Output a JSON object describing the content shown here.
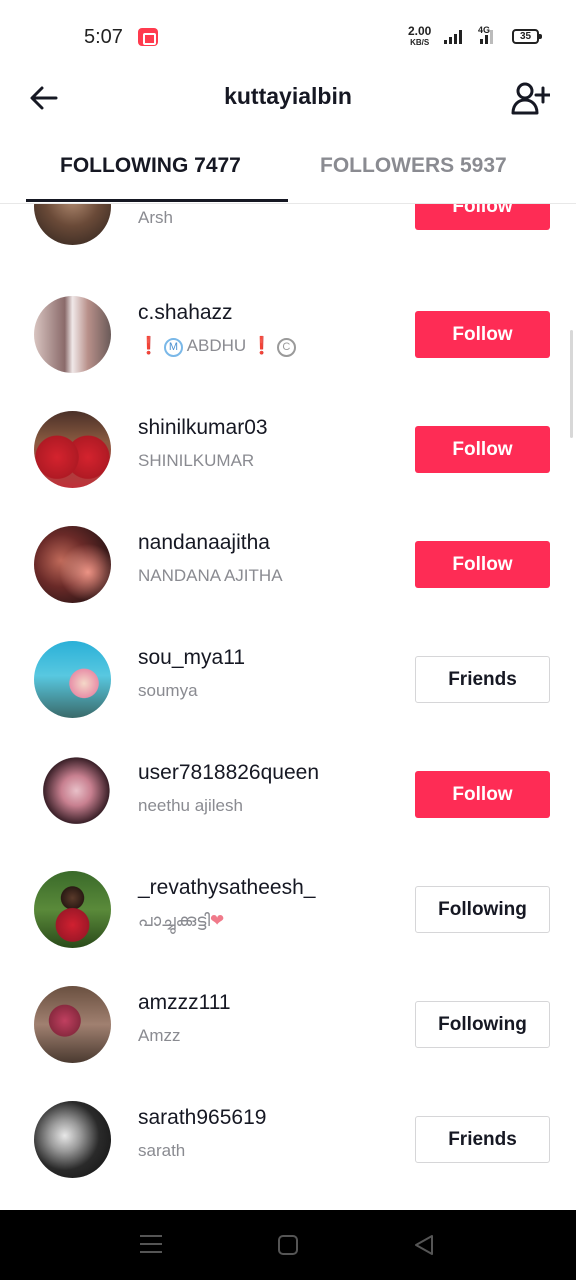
{
  "status_bar": {
    "time": "5:07",
    "net_speed": "2.00",
    "net_speed_unit": "KB/S",
    "network_type": "4G",
    "battery": "35"
  },
  "header": {
    "title": "kuttayialbin",
    "back_icon": "arrow-left-icon",
    "add_icon": "add-user-icon"
  },
  "tabs": [
    {
      "label": "FOLLOWING 7477",
      "active": true
    },
    {
      "label": "FOLLOWERS 5937",
      "active": false
    }
  ],
  "users": [
    {
      "username": "",
      "nickname": "Arsh",
      "button": "Follow"
    },
    {
      "username": "c.shahazz",
      "nickname": "ABDHU",
      "button": "Follow"
    },
    {
      "username": "shinilkumar03",
      "nickname": "SHINILKUMAR",
      "button": "Follow"
    },
    {
      "username": "nandanaajitha",
      "nickname": "NANDANA AJITHA",
      "button": "Follow"
    },
    {
      "username": "sou_mya11",
      "nickname": "soumya",
      "button": "Friends"
    },
    {
      "username": "user7818826queen",
      "nickname": "neethu ajilesh",
      "button": "Follow"
    },
    {
      "username": "_revathysatheesh_",
      "nickname": "പാച്ചുക്കുട്ടി",
      "button": "Following"
    },
    {
      "username": "amzzz111",
      "nickname": "Amzz",
      "button": "Following"
    },
    {
      "username": "sarath965619",
      "nickname": "sarath",
      "button": "Friends"
    }
  ],
  "colors": {
    "accent": "#fe2c55",
    "text_primary": "#161823",
    "text_secondary": "#8a8b91"
  },
  "nav_bar": {
    "icons": [
      "menu-icon",
      "home-icon",
      "back-triangle-icon"
    ]
  }
}
